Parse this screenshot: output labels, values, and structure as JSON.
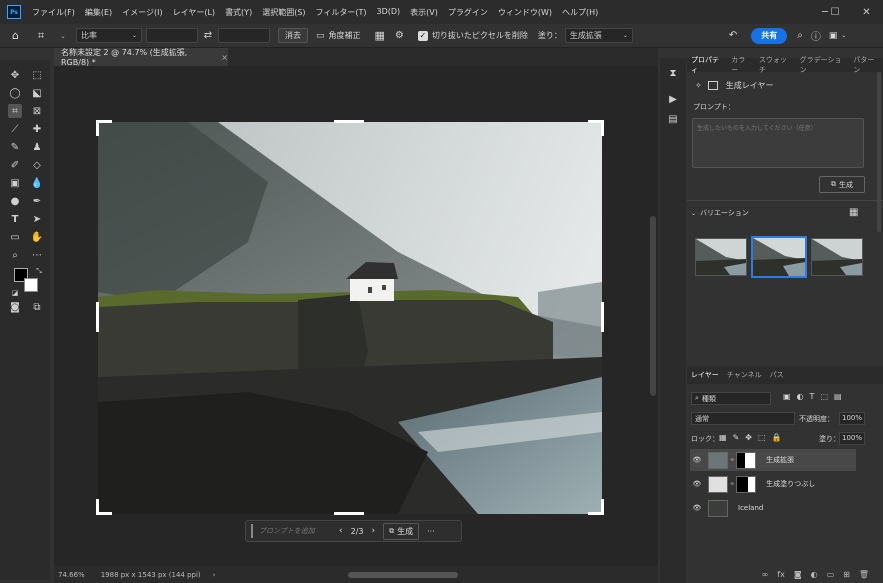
{
  "app": {
    "logo": "Ps"
  },
  "menu": [
    "ファイル(F)",
    "編集(E)",
    "イメージ(I)",
    "レイヤー(L)",
    "書式(Y)",
    "選択範囲(S)",
    "フィルター(T)",
    "3D(D)",
    "表示(V)",
    "プラグイン",
    "ウィンドウ(W)",
    "ヘルプ(H)"
  ],
  "options": {
    "ratio": "比率",
    "clear": "消去",
    "straighten": "角度補正",
    "delete_cropped": "切り抜いたピクセルを削除",
    "fill_label": "塗り：",
    "fill_value": "生成拡張",
    "share": "共有"
  },
  "document": {
    "tab_title": "名称未設定 2 @ 74.7% (生成拡張, RGB/8) *",
    "close": "×"
  },
  "status": {
    "zoom": "74.66%",
    "dims": "1988 px x 1543 px (144 ppi)",
    "arrow": "›"
  },
  "context_bar": {
    "prompt_placeholder": "プロンプトを追加",
    "page": "2/3",
    "generate": "生成",
    "more": "···"
  },
  "properties": {
    "tabs": [
      "プロパティ",
      "カラー",
      "スウォッチ",
      "グラデーション",
      "パターン"
    ],
    "layer_type": "生成レイヤー",
    "prompt_label": "プロンプト：",
    "prompt_placeholder": "生成したいものを入力してください（任意）",
    "generate": "生成",
    "variations_label": "バリエーション"
  },
  "layers": {
    "tabs": [
      "レイヤー",
      "チャンネル",
      "パス"
    ],
    "filter": "種類",
    "blend": "通常",
    "opacity_label": "不透明度：",
    "opacity": "100%",
    "lock_label": "ロック：",
    "fill_label": "塗り：",
    "fill": "100%",
    "items": [
      {
        "name": "生成拡張"
      },
      {
        "name": "生成塗りつぶし"
      },
      {
        "name": "Iceland"
      }
    ]
  }
}
